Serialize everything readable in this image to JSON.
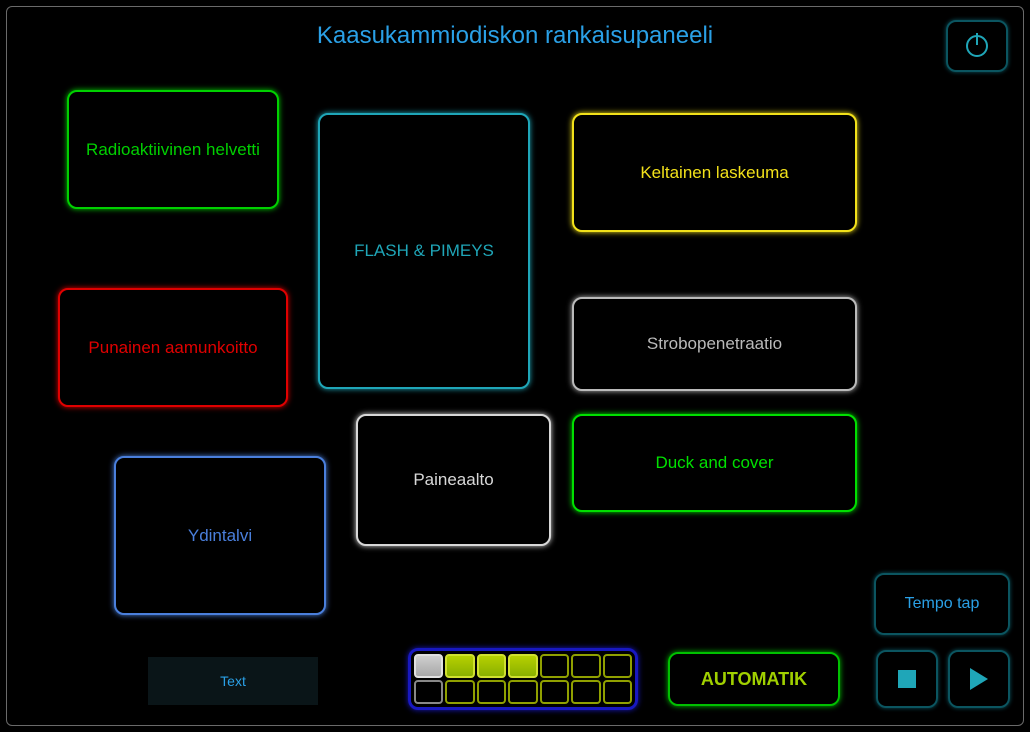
{
  "title": "Kaasukammiodiskon rankaisupaneeli",
  "buttons": {
    "radioaktiivinen": "Radioaktiivinen helvetti",
    "punainen": "Punainen aamunkoitto",
    "ydintalvi": "Ydintalvi",
    "flash": "FLASH & PIMEYS",
    "paineaalto": "Paineaalto",
    "keltainen": "Keltainen laskeuma",
    "strobo": "Strobopenetraatio",
    "duck": "Duck and cover"
  },
  "footer": {
    "text_btn": "Text",
    "automatik": "AUTOMATIK",
    "tempo_tap": "Tempo tap"
  },
  "cue_grid": {
    "rows": 2,
    "cols": 7,
    "cells": [
      [
        "white-fill",
        "lime-fill",
        "lime-fill",
        "lime-fill",
        "lime-outline",
        "lime-outline",
        "lime-outline"
      ],
      [
        "white-outline",
        "lime-outline",
        "lime-outline",
        "lime-outline",
        "lime-outline",
        "lime-outline",
        "lime-outline"
      ]
    ]
  },
  "icons": {
    "power": "power-icon",
    "stop": "stop-icon",
    "play": "play-icon"
  }
}
